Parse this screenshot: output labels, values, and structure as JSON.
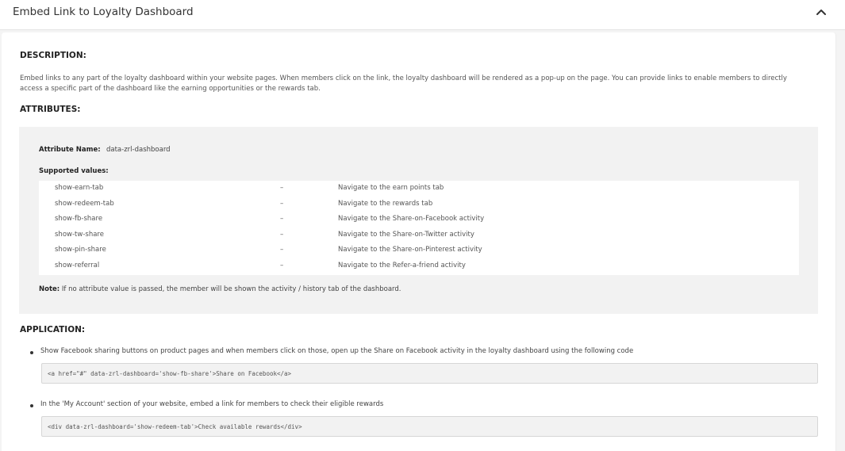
{
  "header": {
    "title": "Embed Link to Loyalty Dashboard",
    "collapse_icon": "chevron-up-icon"
  },
  "description": {
    "heading": "DESCRIPTION:",
    "text": "Embed links to any part of the loyalty dashboard within your website pages. When members click on the link, the loyalty dashboard will be rendered as a pop-up on the page. You can provide links to enable members to directly access a specific part of the dashboard like the earning opportunities or the rewards tab."
  },
  "attributes": {
    "heading": "ATTRIBUTES:",
    "name_label": "Attribute Name:",
    "name_value": "data-zrl-dashboard",
    "supported_label": "Supported values:",
    "values": [
      {
        "value": "show-earn-tab",
        "dash": "–",
        "desc": "Navigate to the earn points tab"
      },
      {
        "value": "show-redeem-tab",
        "dash": "–",
        "desc": "Navigate to the rewards tab"
      },
      {
        "value": "show-fb-share",
        "dash": "–",
        "desc": "Navigate to the Share-on-Facebook activity"
      },
      {
        "value": "show-tw-share",
        "dash": "–",
        "desc": "Navigate to the Share-on-Twitter activity"
      },
      {
        "value": "show-pin-share",
        "dash": "–",
        "desc": "Navigate to the Share-on-Pinterest activity"
      },
      {
        "value": "show-referral",
        "dash": "–",
        "desc": "Navigate to the Refer-a-friend activity"
      }
    ],
    "note_label": "Note:",
    "note_text": " If no attribute value is passed, the member will be shown the activity / history tab of the dashboard."
  },
  "application": {
    "heading": "APPLICATION:",
    "items": [
      {
        "text": "Show Facebook sharing buttons on product pages and when members click on those, open up the Share on Facebook activity in the loyalty dashboard using the following code",
        "code": "<a href=\"#\" data-zrl-dashboard='show-fb-share'>Share on Facebook</a>"
      },
      {
        "text": "In the 'My Account' section of your website, embed a link for members to check their eligible rewards",
        "code": "<div data-zrl-dashboard='show-redeem-tab'>Check available rewards</div>"
      }
    ]
  }
}
